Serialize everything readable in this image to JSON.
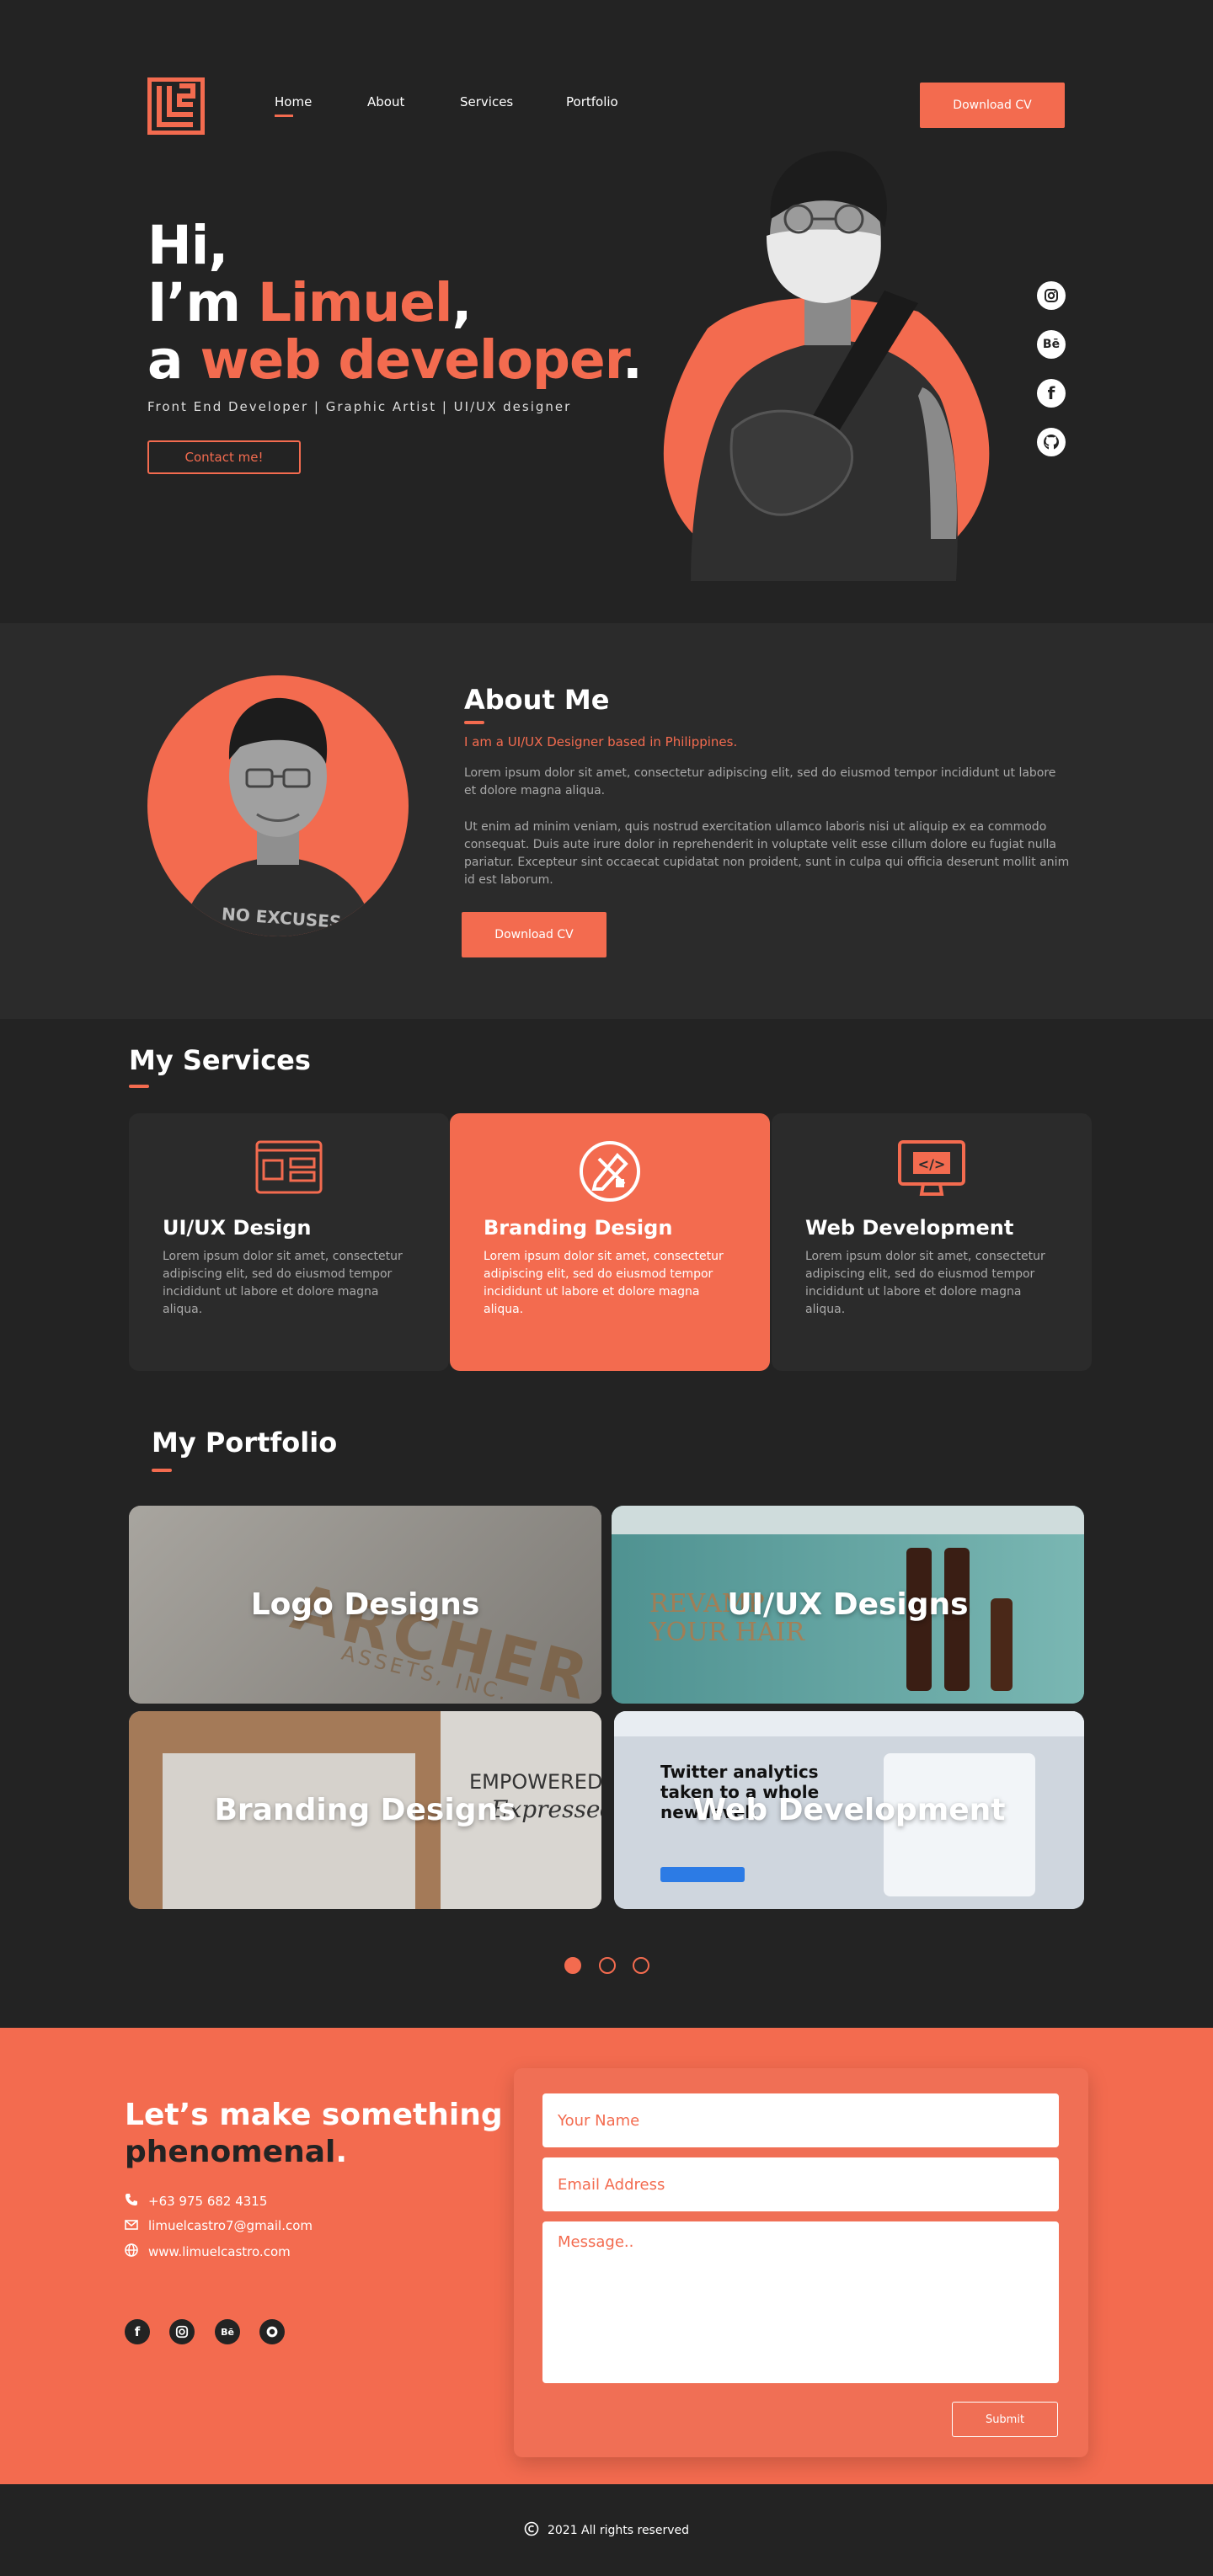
{
  "nav": {
    "items": [
      {
        "label": "Home",
        "active": true
      },
      {
        "label": "About",
        "active": false
      },
      {
        "label": "Services",
        "active": false
      },
      {
        "label": "Portfolio",
        "active": false
      }
    ],
    "download_label": "Download CV"
  },
  "hero": {
    "line1": "Hi,",
    "line2_prefix": "I’m ",
    "line2_name": "Limuel",
    "line2_suffix": ",",
    "line3_prefix": "a ",
    "line3_role": "web developer",
    "line3_suffix": ".",
    "tagline": "Front End Developer | Graphic Artist | UI/UX designer",
    "cta_label": "Contact me!",
    "social_icons": [
      "instagram-icon",
      "behance-icon",
      "facebook-icon",
      "github-icon"
    ]
  },
  "about": {
    "title": "About Me",
    "subtitle": "I am a UI/UX Designer based in Philippines.",
    "para1": "Lorem ipsum dolor sit amet, consectetur adipiscing elit, sed do eiusmod tempor incididunt ut labore et dolore magna aliqua.",
    "para2": "Ut enim ad minim veniam, quis nostrud exercitation ullamco laboris nisi ut aliquip ex ea commodo consequat. Duis aute irure dolor in reprehenderit in voluptate velit esse cillum dolore eu fugiat nulla pariatur. Excepteur sint occaecat cupidatat non proident, sunt in culpa qui officia deserunt mollit anim id est laborum.",
    "button_label": "Download CV",
    "shirt_text": "NO EXCUSES"
  },
  "services": {
    "title": "My Services",
    "items": [
      {
        "title": "UI/UX Design",
        "text": "Lorem ipsum dolor sit amet, consectetur adipiscing elit, sed do eiusmod tempor incididunt ut labore et dolore magna aliqua.",
        "icon": "layout-icon"
      },
      {
        "title": "Branding Design",
        "text": "Lorem ipsum dolor sit amet, consectetur adipiscing elit, sed do eiusmod tempor incididunt ut labore et dolore magna aliqua.",
        "icon": "design-tools-icon"
      },
      {
        "title": "Web Development",
        "text": "Lorem ipsum dolor sit amet, consectetur adipiscing elit, sed do eiusmod tempor incididunt ut labore et dolore magna aliqua.",
        "icon": "code-monitor-icon"
      }
    ]
  },
  "portfolio": {
    "title": "My Portfolio",
    "items": [
      {
        "label": "Logo Designs"
      },
      {
        "label": "UI/UX Designs"
      },
      {
        "label": "Branding Designs"
      },
      {
        "label": "Web Development"
      }
    ],
    "logo_mock_text": "ARCHER",
    "logo_mock_sub": "ASSETS, INC.",
    "uiux_mock_text1": "REVAMP",
    "uiux_mock_text2": "YOUR HAIR",
    "brand_mock_text": "EMPOWERED",
    "brand_mock_script": "Expressed",
    "web_mock_headline": "Twitter analytics taken to a whole new level.",
    "active_slide": 1,
    "slide_count": 3
  },
  "contact": {
    "heading_line1": "Let’s make something",
    "heading_line2": "phenomenal",
    "heading_dot": ".",
    "phone": "+63 975 682 4315",
    "email": "limuelcastro7@gmail.com",
    "website": "www.limuelcastro.com",
    "social_icons": [
      "facebook-icon",
      "instagram-icon",
      "behance-icon",
      "github-icon"
    ],
    "name_placeholder": "Your Name",
    "email_placeholder": "Email Address",
    "message_placeholder": "Message..",
    "submit_label": "Submit"
  },
  "footer": {
    "copyright": "2021 All rights reserved"
  },
  "colors": {
    "accent": "#f36b4f",
    "background": "#232323",
    "panel": "#2b2b2b"
  }
}
